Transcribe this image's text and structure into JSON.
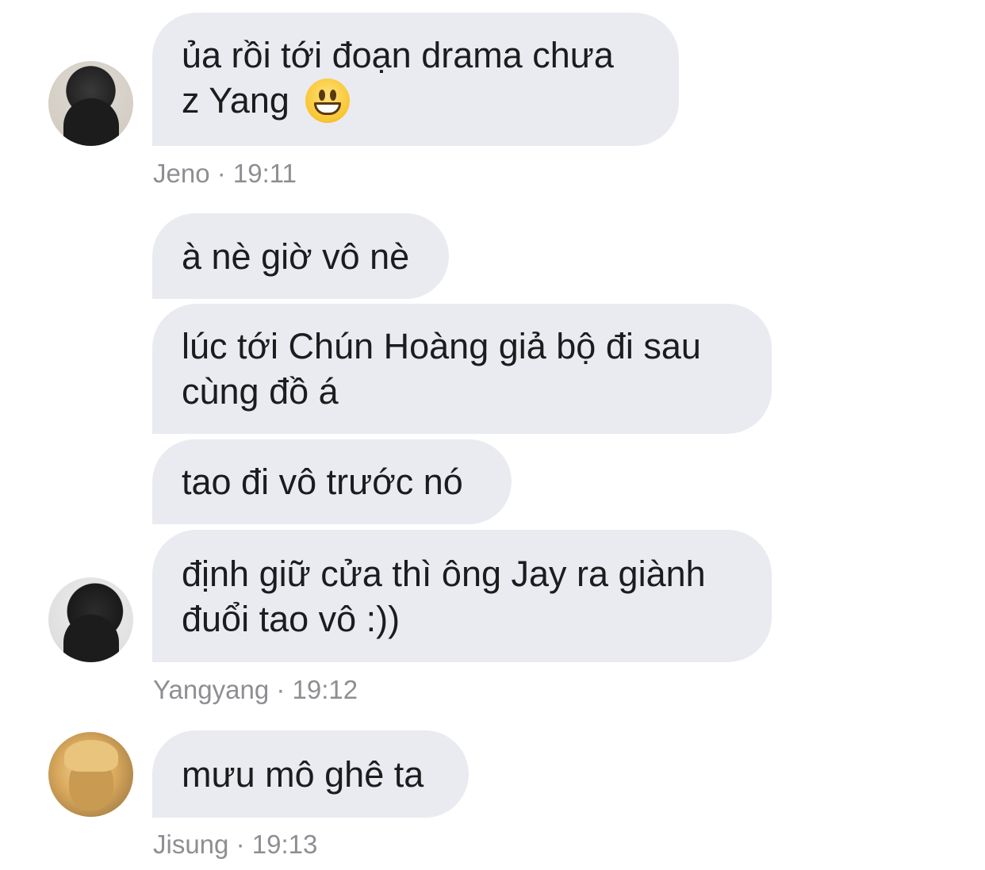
{
  "messages": [
    {
      "lines": [
        "ủa rồi tới đoạn drama chưa",
        "z Yang"
      ],
      "emoji": "grinning-face-icon"
    },
    {
      "lines": [
        "à nè giờ vô nè"
      ]
    },
    {
      "lines": [
        "lúc tới Chún Hoàng giả bộ đi sau",
        "cùng đồ á"
      ]
    },
    {
      "lines": [
        "tao đi vô trước nó"
      ]
    },
    {
      "lines": [
        "định giữ cửa thì ông Jay ra giành",
        "đuổi tao vô :))"
      ]
    },
    {
      "lines": [
        "mưu mô ghê ta"
      ]
    }
  ],
  "meta": [
    {
      "sender": "Jeno",
      "sep": "·",
      "time": "19:11"
    },
    {
      "sender": "Yangyang",
      "sep": "·",
      "time": "19:12"
    },
    {
      "sender": "Jisung",
      "sep": "·",
      "time": "19:13"
    }
  ],
  "colors": {
    "bubble": "#e9ebf0",
    "text": "#1c1c1e",
    "meta": "#8e8e93"
  }
}
